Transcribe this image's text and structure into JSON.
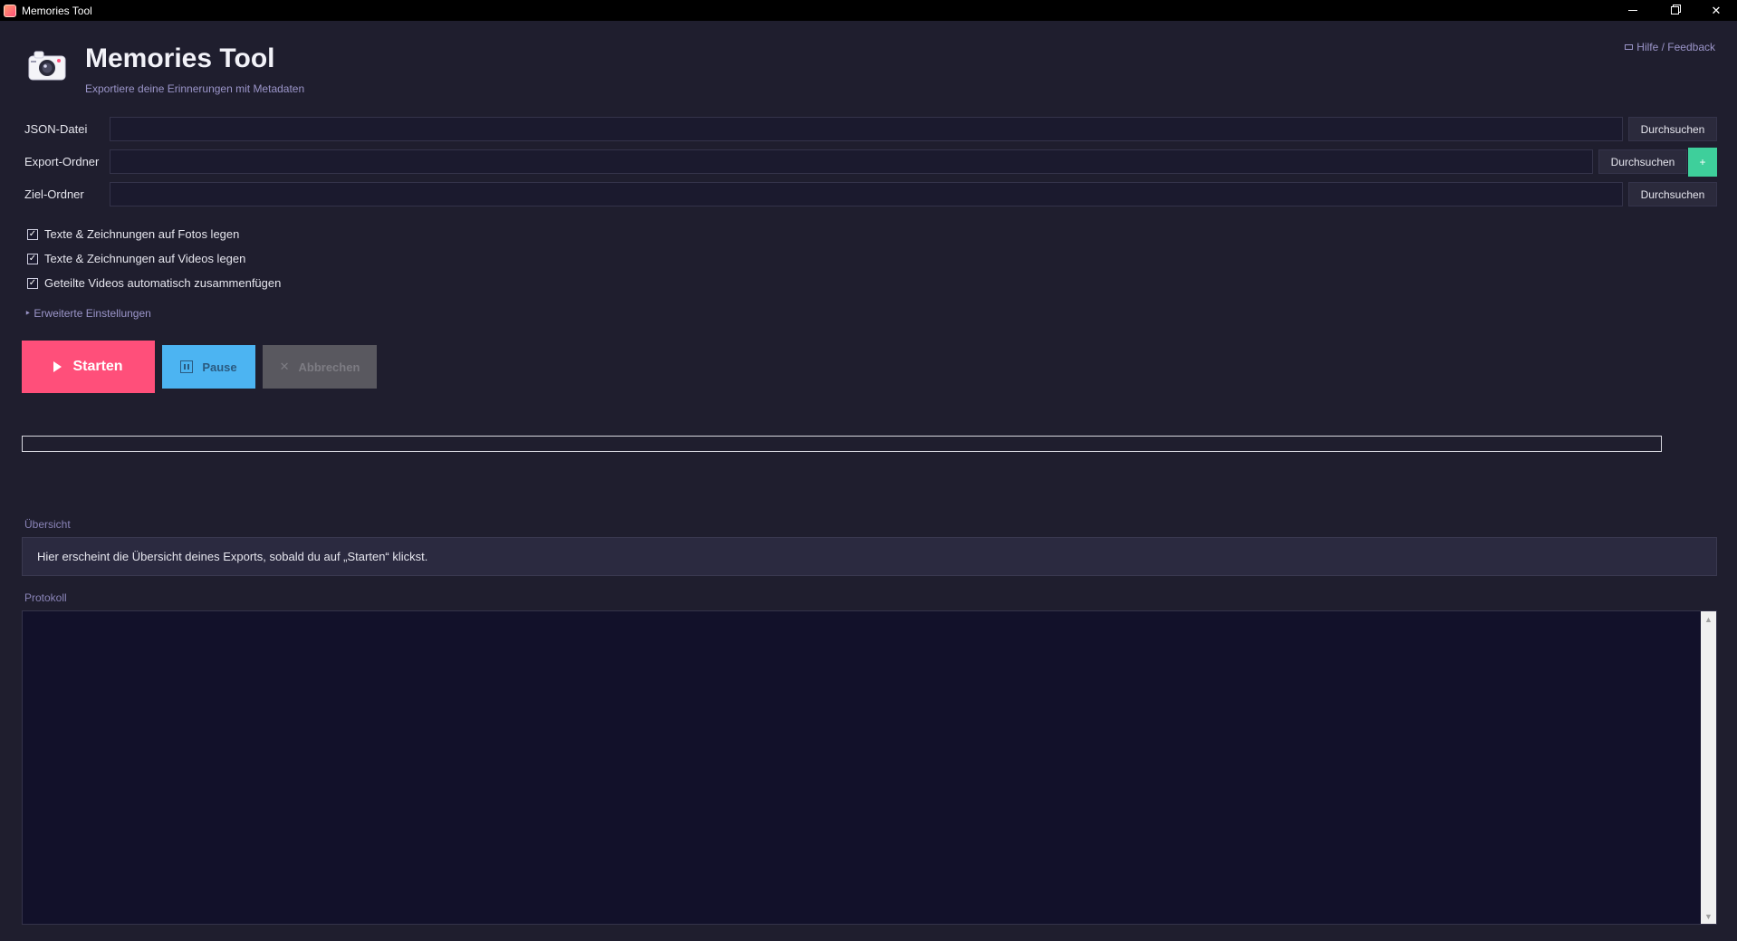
{
  "window": {
    "title": "Memories Tool",
    "controls": {
      "minimize": "—",
      "maximize": "❐",
      "close": "✕"
    }
  },
  "header": {
    "icon": "camera-icon",
    "title": "Memories Tool",
    "subtitle": "Exportiere deine Erinnerungen mit Metadaten",
    "help_label": "Hilfe / Feedback"
  },
  "paths": [
    {
      "label": "JSON-Datei",
      "value": "",
      "placeholder": "",
      "browse_label": "Durchsuchen"
    },
    {
      "label": "Export-Ordner",
      "value": "",
      "placeholder": "",
      "browse_label": "Durchsuchen",
      "add_label": "+"
    },
    {
      "label": "Ziel-Ordner",
      "value": "",
      "placeholder": "",
      "browse_label": "Durchsuchen"
    }
  ],
  "options": [
    {
      "label": "Texte & Zeichnungen auf Fotos legen",
      "checked": true
    },
    {
      "label": "Texte & Zeichnungen auf Videos legen",
      "checked": true
    },
    {
      "label": "Geteilte Videos automatisch zusammenfügen",
      "checked": true
    }
  ],
  "advanced_label": "‣ Erweiterte Einstellungen",
  "actions": {
    "start_label": "Starten",
    "pause_label": "Pause",
    "cancel_label": "Abbrechen",
    "cancel_icon": "✕"
  },
  "progress": {
    "value": 0
  },
  "summary": {
    "label": "Übersicht",
    "text": "Hier erscheint die Übersicht deines Exports, sobald du auf „Starten“ klickst."
  },
  "log": {
    "label": "Protokoll",
    "content": ""
  },
  "colors": {
    "background": "#1f1e2e",
    "accent_start": "#ff4f7a",
    "accent_pause": "#4cb4f2",
    "accent_add": "#3ecf9b",
    "muted_text": "#9b95c9"
  }
}
